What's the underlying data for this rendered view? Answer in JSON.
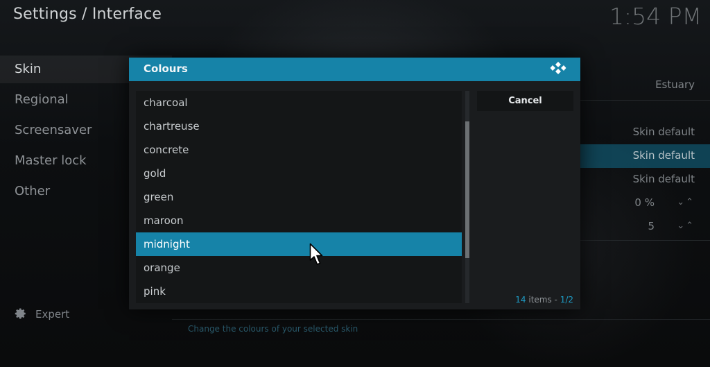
{
  "header": {
    "title": "Settings / Interface",
    "clock": "1:54 PM"
  },
  "sidebar": {
    "items": [
      {
        "label": "Skin",
        "active": true
      },
      {
        "label": "Regional"
      },
      {
        "label": "Screensaver"
      },
      {
        "label": "Master lock"
      },
      {
        "label": "Other"
      }
    ],
    "expert_label": "Expert"
  },
  "settings_values": {
    "skin": "Estuary",
    "row2": "Skin default",
    "row3": "Skin default",
    "row4": "Skin default",
    "zoom": "0 %",
    "stereo": "5"
  },
  "hint_text": "Change the colours of your selected skin",
  "dialog": {
    "title": "Colours",
    "cancel_label": "Cancel",
    "items": [
      "charcoal",
      "chartreuse",
      "concrete",
      "gold",
      "green",
      "maroon",
      "midnight",
      "orange",
      "pink"
    ],
    "selected_index": 6,
    "count_number": "14",
    "count_suffix": " items - ",
    "page": "1/2"
  },
  "colors": {
    "accent": "#1683a8",
    "background": "#0c0e10"
  },
  "icons": {
    "logo": "kodi-logo-icon",
    "gear": "gear-icon",
    "cursor": "mouse-pointer-icon"
  }
}
